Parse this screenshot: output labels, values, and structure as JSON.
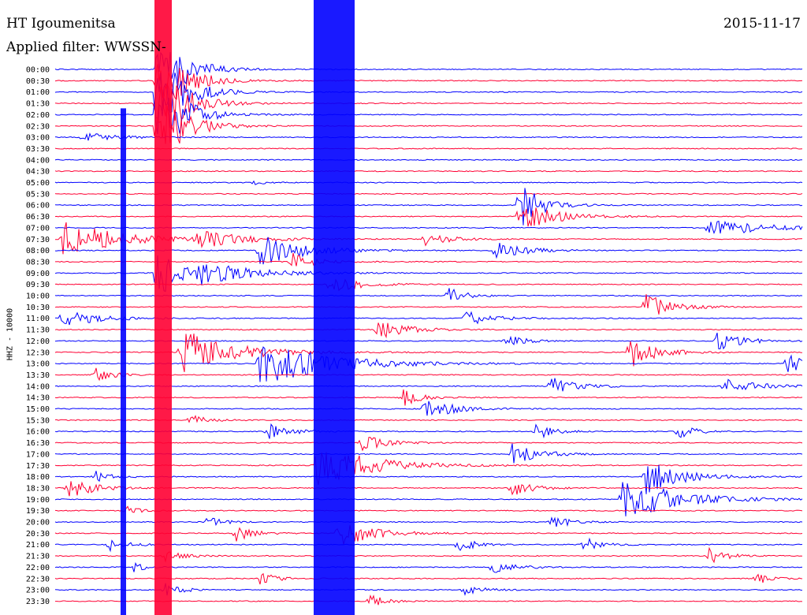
{
  "header": {
    "station": "HT Igoumenitsa",
    "date": "2015-11-17",
    "filter_label": "Applied filter: WWSSN-"
  },
  "colors": {
    "trace_a": "#0000ff",
    "trace_b": "#ff0033",
    "background": "#ffffff",
    "text": "#000000"
  },
  "chart_data": {
    "type": "line",
    "title": "HT Igoumenitsa",
    "subtitle": "Applied filter: WWSSN-",
    "ylabel": "HHZ - 10000",
    "xlabel": "",
    "grid": false,
    "legend": "none",
    "series": [
      {
        "color": "#0000ff"
      },
      {
        "color": "#ff0033"
      }
    ],
    "row_labels": [
      "00:00",
      "00:30",
      "01:00",
      "01:30",
      "02:00",
      "02:30",
      "03:00",
      "03:30",
      "04:00",
      "04:30",
      "05:00",
      "05:30",
      "06:00",
      "06:30",
      "07:00",
      "07:30",
      "08:00",
      "08:30",
      "09:00",
      "09:30",
      "10:00",
      "10:30",
      "11:00",
      "11:30",
      "12:00",
      "12:30",
      "13:00",
      "13:30",
      "14:00",
      "14:30",
      "15:00",
      "15:30",
      "16:00",
      "16:30",
      "17:00",
      "17:30",
      "18:00",
      "18:30",
      "19:00",
      "19:30",
      "20:00",
      "20:30",
      "21:00",
      "21:30",
      "22:00",
      "22:30",
      "23:00",
      "23:30"
    ]
  }
}
